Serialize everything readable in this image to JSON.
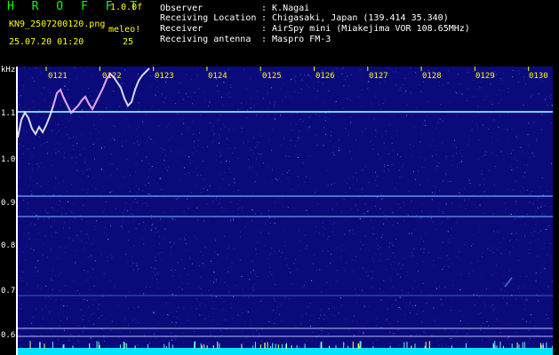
{
  "header": {
    "brand": "H R O F F T",
    "version": "1.0.0f",
    "filename": "KN9_2507200120.png",
    "mode": "meleo!",
    "datetime": "25.07.20 01:20",
    "count": "25",
    "fields": [
      {
        "label": "Observer",
        "value": ": K.Nagai"
      },
      {
        "label": "Receiving Location",
        "value": ": Chigasaki, Japan (139.414 35.340)"
      },
      {
        "label": "Receiver",
        "value": ": AirSpy mini (Miakejima VOR 108.65MHz)"
      },
      {
        "label": "Receiving antenna",
        "value": ": Maspro FM-3"
      }
    ]
  },
  "axis": {
    "unit": "kHz",
    "y_ticks": [
      "1.1",
      "1.0",
      "0.9",
      "0.8",
      "0.7",
      "0.6"
    ],
    "time_labels": [
      "0121",
      "0122",
      "0123",
      "0124",
      "0125",
      "0126",
      "0127",
      "0128",
      "0129",
      "0130"
    ]
  },
  "colors": {
    "background": "#000000",
    "spectrogram": "#0a0a7a",
    "carrier": "#66ddff",
    "echo": "#ff66ff",
    "label_yellow": "#ffff00",
    "label_green": "#00ff00",
    "bottom_band": "#00e5ff"
  }
}
